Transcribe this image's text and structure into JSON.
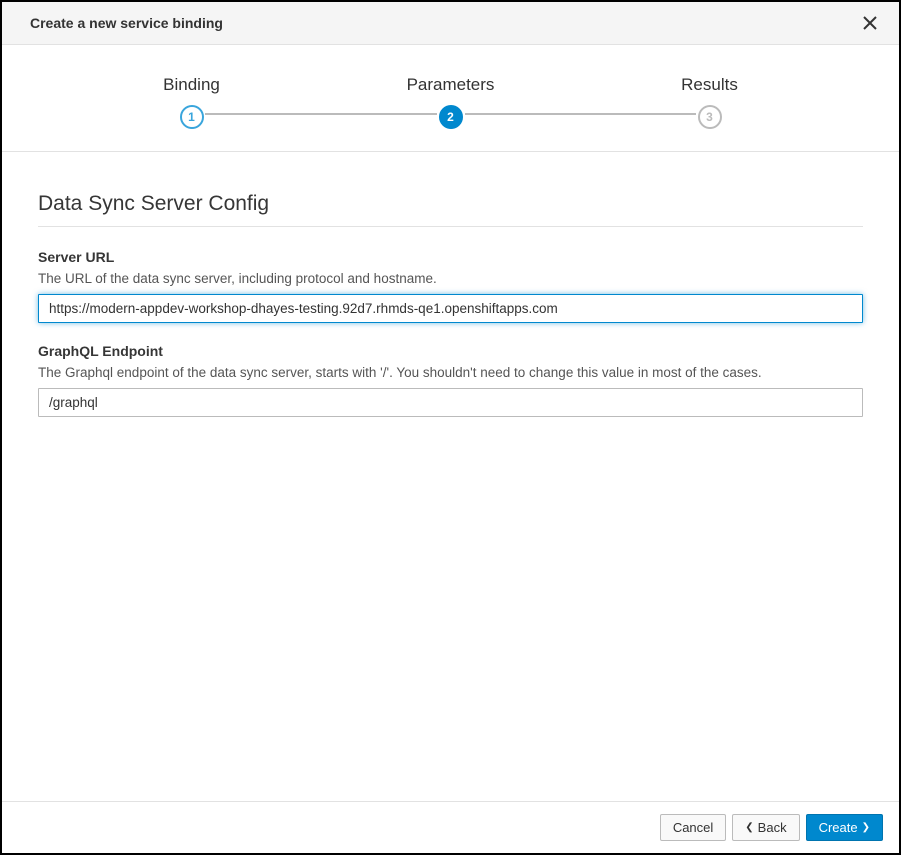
{
  "header": {
    "title": "Create a new service binding"
  },
  "steps": {
    "step1": {
      "label": "Binding",
      "num": "1"
    },
    "step2": {
      "label": "Parameters",
      "num": "2"
    },
    "step3": {
      "label": "Results",
      "num": "3"
    }
  },
  "form": {
    "section_title": "Data Sync Server Config",
    "server_url": {
      "label": "Server URL",
      "hint": "The URL of the data sync server, including protocol and hostname.",
      "value": "https://modern-appdev-workshop-dhayes-testing.92d7.rhmds-qe1.openshiftapps.com"
    },
    "graphql": {
      "label": "GraphQL Endpoint",
      "hint": "The Graphql endpoint of the data sync server, starts with '/'. You shouldn't need to change this value in most of the cases.",
      "value": "/graphql"
    }
  },
  "footer": {
    "cancel": "Cancel",
    "back": "Back",
    "create": "Create"
  }
}
